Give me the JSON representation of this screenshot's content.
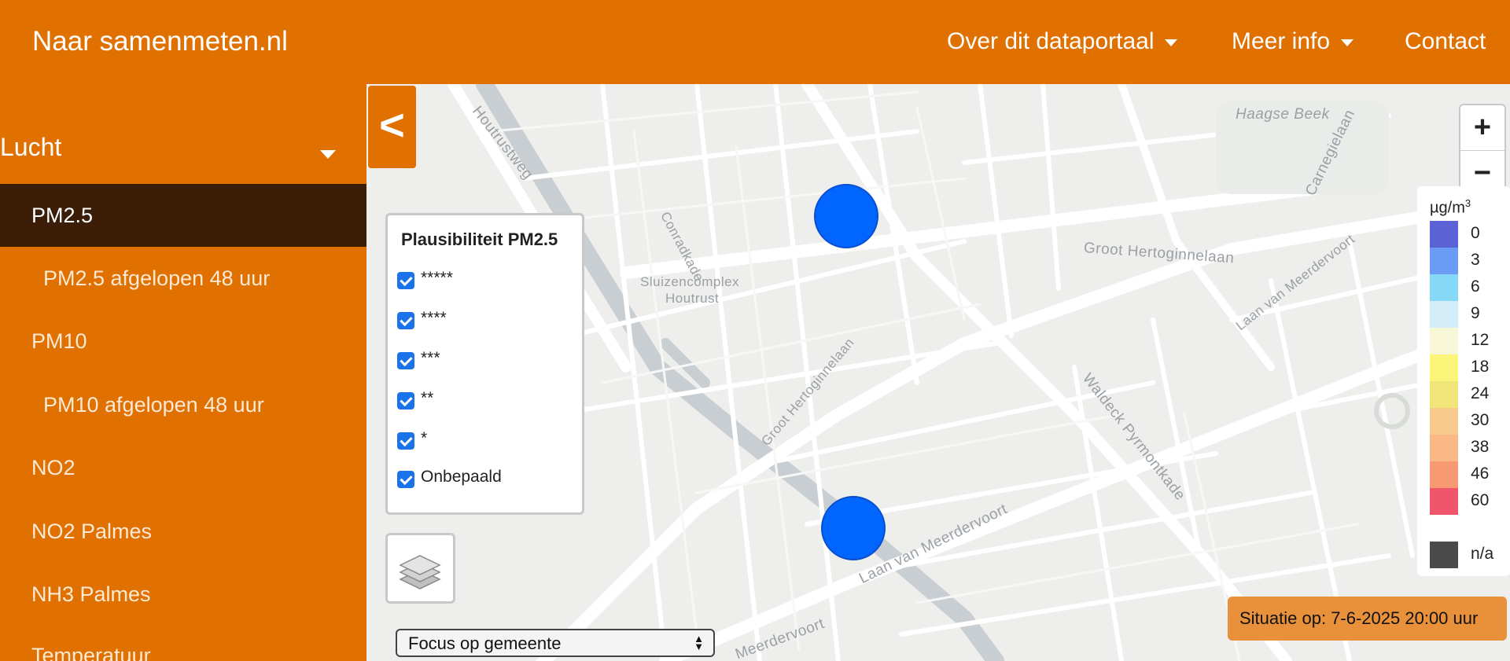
{
  "header": {
    "brand": "Naar samenmeten.nl",
    "nav": [
      {
        "label": "Over dit dataportaal",
        "dropdown": true
      },
      {
        "label": "Meer info",
        "dropdown": true
      },
      {
        "label": "Contact",
        "dropdown": false
      }
    ]
  },
  "sidebar": {
    "category": "Lucht",
    "items": [
      {
        "label": "PM2.5",
        "active": true,
        "sub": false
      },
      {
        "label": "PM2.5 afgelopen 48 uur",
        "active": false,
        "sub": true
      },
      {
        "label": "PM10",
        "active": false,
        "sub": false
      },
      {
        "label": "PM10 afgelopen 48 uur",
        "active": false,
        "sub": true
      },
      {
        "label": "NO2",
        "active": false,
        "sub": false
      },
      {
        "label": "NO2 Palmes",
        "active": false,
        "sub": false
      },
      {
        "label": "NH3 Palmes",
        "active": false,
        "sub": false
      },
      {
        "label": "Temperatuur",
        "active": false,
        "sub": false
      }
    ]
  },
  "map": {
    "collapse_label": "<",
    "street_labels": [
      "Houtrustweg",
      "Haagse Beek",
      "Carnegielaan",
      "Conradkade",
      "Sluizencomplex",
      "Houtrust",
      "Groot Hertoginnelaan",
      "Groot Hertoginnelaan",
      "Laan van Meerdervoort",
      "Waldeck Pyrmontkade",
      "Laan van Meerdervoort",
      "Meerdervoort"
    ],
    "plausibility": {
      "title": "Plausibiliteit PM2.5",
      "options": [
        {
          "label": "*****",
          "checked": true
        },
        {
          "label": "****",
          "checked": true
        },
        {
          "label": "***",
          "checked": true
        },
        {
          "label": "**",
          "checked": true
        },
        {
          "label": "*",
          "checked": true
        },
        {
          "label": "Onbepaald",
          "checked": true
        }
      ]
    },
    "layers_icon": "layers-icon",
    "focus_select": "Focus op gemeente",
    "zoom_in": "+",
    "zoom_out": "−",
    "legend": {
      "unit": "µg/m",
      "unit_sup": "3",
      "entries": [
        {
          "value": "0",
          "color": "#5b62d6"
        },
        {
          "value": "3",
          "color": "#6a9cf5"
        },
        {
          "value": "6",
          "color": "#86d8f7"
        },
        {
          "value": "9",
          "color": "#d3eef8"
        },
        {
          "value": "12",
          "color": "#f7f6d6"
        },
        {
          "value": "18",
          "color": "#fbf57a"
        },
        {
          "value": "24",
          "color": "#f1e579"
        },
        {
          "value": "30",
          "color": "#f7c98a"
        },
        {
          "value": "38",
          "color": "#fbb887"
        },
        {
          "value": "46",
          "color": "#f79a74"
        },
        {
          "value": "60",
          "color": "#ef566c"
        }
      ],
      "na": {
        "value": "n/a",
        "color": "#4a4a4a"
      }
    },
    "status": "Situatie op: 7-6-2025 20:00 uur",
    "accent_color": "#e07000",
    "marker_color": "#0066ff"
  }
}
